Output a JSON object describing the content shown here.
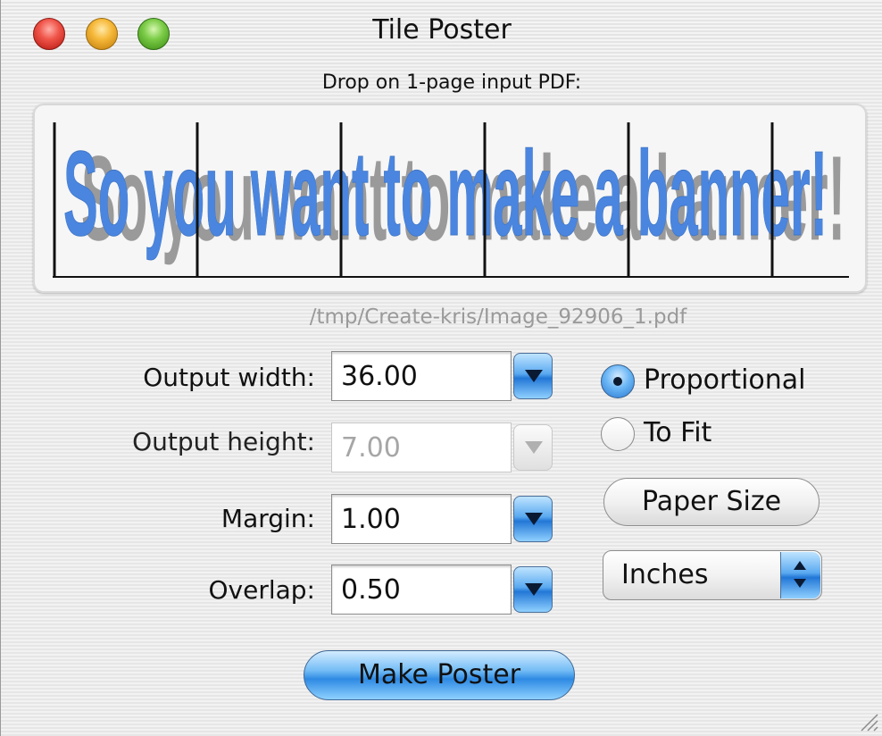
{
  "window": {
    "title": "Tile Poster"
  },
  "drop": {
    "label": "Drop on 1-page input PDF:",
    "preview_text": "So you want to make a banner!",
    "file_path": "/tmp/Create-kris/Image_92906_1.pdf"
  },
  "fields": {
    "output_width": {
      "label": "Output width:",
      "value": "36.00"
    },
    "output_height": {
      "label": "Output height:",
      "value": "7.00"
    },
    "margin": {
      "label": "Margin:",
      "value": "1.00"
    },
    "overlap": {
      "label": "Overlap:",
      "value": "0.50"
    }
  },
  "scaling": {
    "proportional_label": "Proportional",
    "to_fit_label": "To Fit",
    "selected": "Proportional"
  },
  "paper_size_label": "Paper Size",
  "units": {
    "selected": "Inches"
  },
  "make_poster_label": "Make Poster",
  "colors": {
    "banner_text": "#4a86e0",
    "banner_shadow": "#9a9a9a",
    "aqua": "#2e8ae3"
  }
}
